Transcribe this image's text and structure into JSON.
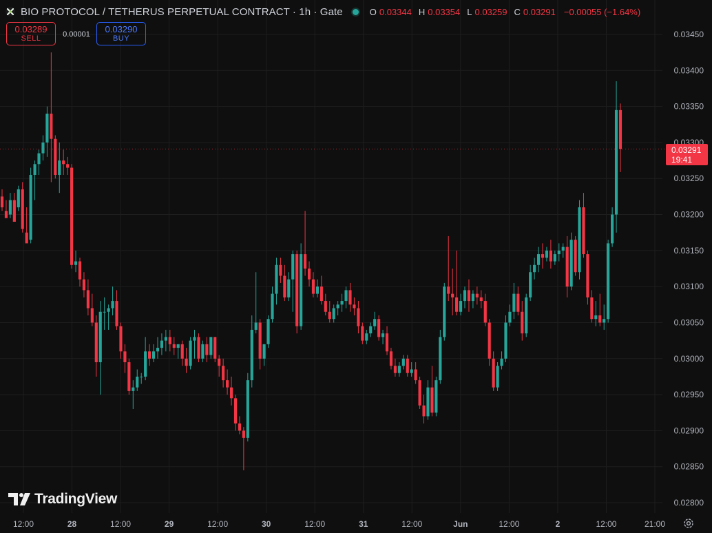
{
  "header": {
    "title": "BIO PROTOCOL / TETHERUS PERPETUAL CONTRACT · 1h · Gate",
    "ohlc": [
      {
        "k": "O",
        "v": "0.03344"
      },
      {
        "k": "H",
        "v": "0.03354"
      },
      {
        "k": "L",
        "v": "0.03259"
      },
      {
        "k": "C",
        "v": "0.03291"
      }
    ],
    "change": "−0.00055 (−1.64%)"
  },
  "trade": {
    "sell_price": "0.03289",
    "sell_label": "SELL",
    "spread": "0.00001",
    "buy_price": "0.03290",
    "buy_label": "BUY"
  },
  "price_tag": {
    "price": "0.03291",
    "countdown": "19:41"
  },
  "branding": {
    "name": "TradingView"
  },
  "colors": {
    "up": "#26a69a",
    "down": "#f23645",
    "background": "#0f0f0f",
    "grid": "#1e1e1e",
    "axis_text": "#b2b5be"
  },
  "chart_data": {
    "type": "candlestick",
    "title": "BIO PROTOCOL / TETHERUS PERPETUAL CONTRACT · 1h · Gate",
    "ylim": [
      0.028,
      0.0345
    ],
    "y_ticks": [
      "0.03450",
      "0.03400",
      "0.03350",
      "0.03300",
      "0.03250",
      "0.03200",
      "0.03150",
      "0.03100",
      "0.03050",
      "0.03000",
      "0.02950",
      "0.02900",
      "0.02850",
      "0.02800"
    ],
    "x_ticks": [
      "12:00",
      "28",
      "12:00",
      "29",
      "12:00",
      "30",
      "12:00",
      "31",
      "12:00",
      "Jun",
      "12:00",
      "2",
      "12:00",
      "21:00"
    ],
    "grid": true,
    "last_price": 0.03291,
    "candles": [
      [
        0.03225,
        0.03235,
        0.0321,
        0.03205
      ],
      [
        0.03205,
        0.0322,
        0.03195,
        0.032
      ],
      [
        0.032,
        0.0323,
        0.0322,
        0.03195
      ],
      [
        0.0322,
        0.0323,
        0.0319,
        0.0321
      ],
      [
        0.0321,
        0.0324,
        0.03235,
        0.03205
      ],
      [
        0.03235,
        0.03245,
        0.0318,
        0.03175
      ],
      [
        0.03175,
        0.0321,
        0.0316,
        0.03165
      ],
      [
        0.03165,
        0.03265,
        0.03255,
        0.0316
      ],
      [
        0.03255,
        0.03275,
        0.0327,
        0.0322
      ],
      [
        0.0327,
        0.0329,
        0.03285,
        0.03255
      ],
      [
        0.03285,
        0.0331,
        0.033,
        0.03275
      ],
      [
        0.033,
        0.0335,
        0.0334,
        0.0328
      ],
      [
        0.0334,
        0.03425,
        0.03305,
        0.03245
      ],
      [
        0.03305,
        0.0331,
        0.03255,
        0.0325
      ],
      [
        0.03255,
        0.033,
        0.03275,
        0.0323
      ],
      [
        0.03275,
        0.0329,
        0.0327,
        0.03255
      ],
      [
        0.0327,
        0.0328,
        0.03265,
        0.03255
      ],
      [
        0.03265,
        0.0327,
        0.0313,
        0.03125
      ],
      [
        0.0313,
        0.0315,
        0.03135,
        0.0312
      ],
      [
        0.03135,
        0.0314,
        0.0311,
        0.031
      ],
      [
        0.0311,
        0.0312,
        0.03095,
        0.03085
      ],
      [
        0.03095,
        0.0311,
        0.0307,
        0.0306
      ],
      [
        0.0307,
        0.0309,
        0.0305,
        0.03045
      ],
      [
        0.0305,
        0.0306,
        0.02995,
        0.02975
      ],
      [
        0.02995,
        0.0308,
        0.03065,
        0.0295
      ],
      [
        0.03065,
        0.03085,
        0.03065,
        0.0304
      ],
      [
        0.03065,
        0.03075,
        0.0307,
        0.0304
      ],
      [
        0.0307,
        0.031,
        0.0308,
        0.0306
      ],
      [
        0.0308,
        0.03095,
        0.03045,
        0.0304
      ],
      [
        0.03045,
        0.0305,
        0.0301,
        0.03
      ],
      [
        0.0301,
        0.0302,
        0.02995,
        0.0298
      ],
      [
        0.02995,
        0.03,
        0.02955,
        0.0295
      ],
      [
        0.02955,
        0.0297,
        0.0296,
        0.0293
      ],
      [
        0.0296,
        0.02985,
        0.02975,
        0.02955
      ],
      [
        0.02975,
        0.0298,
        0.02975,
        0.02965
      ],
      [
        0.02975,
        0.0303,
        0.0301,
        0.0297
      ],
      [
        0.0301,
        0.0302,
        0.03,
        0.0299
      ],
      [
        0.03,
        0.0302,
        0.0301,
        0.02995
      ],
      [
        0.0301,
        0.0303,
        0.03015,
        0.03
      ],
      [
        0.03015,
        0.03035,
        0.03025,
        0.03005
      ],
      [
        0.03025,
        0.0304,
        0.0303,
        0.0301
      ],
      [
        0.0303,
        0.0304,
        0.0302,
        0.0301
      ],
      [
        0.0302,
        0.0303,
        0.03015,
        0.03005
      ],
      [
        0.03015,
        0.0302,
        0.0302,
        0.03
      ],
      [
        0.0302,
        0.03025,
        0.03,
        0.0299
      ],
      [
        0.03,
        0.03015,
        0.0299,
        0.0298
      ],
      [
        0.0299,
        0.0303,
        0.03025,
        0.02985
      ],
      [
        0.03025,
        0.0304,
        0.0303,
        0.03
      ],
      [
        0.0303,
        0.03035,
        0.03,
        0.02995
      ],
      [
        0.03,
        0.03025,
        0.0302,
        0.02995
      ],
      [
        0.0302,
        0.0303,
        0.03005,
        0.02995
      ],
      [
        0.03005,
        0.0303,
        0.0303,
        0.03
      ],
      [
        0.0303,
        0.0303,
        0.03,
        0.02995
      ],
      [
        0.03,
        0.03005,
        0.0299,
        0.02975
      ],
      [
        0.0299,
        0.03,
        0.0297,
        0.0296
      ],
      [
        0.0297,
        0.02985,
        0.0296,
        0.0295
      ],
      [
        0.0296,
        0.02975,
        0.02945,
        0.02935
      ],
      [
        0.02945,
        0.0295,
        0.0291,
        0.029
      ],
      [
        0.0291,
        0.0292,
        0.029,
        0.02895
      ],
      [
        0.029,
        0.02905,
        0.0289,
        0.02845
      ],
      [
        0.0289,
        0.0298,
        0.0297,
        0.02885
      ],
      [
        0.0297,
        0.0306,
        0.0304,
        0.0296
      ],
      [
        0.0304,
        0.0312,
        0.0305,
        0.03035
      ],
      [
        0.0305,
        0.03055,
        0.03,
        0.02985
      ],
      [
        0.03,
        0.0302,
        0.0302,
        0.0299
      ],
      [
        0.0302,
        0.0306,
        0.03055,
        0.03015
      ],
      [
        0.03055,
        0.031,
        0.0309,
        0.0305
      ],
      [
        0.0309,
        0.0314,
        0.0313,
        0.03075
      ],
      [
        0.0313,
        0.0314,
        0.03115,
        0.03105
      ],
      [
        0.03115,
        0.0313,
        0.03085,
        0.0308
      ],
      [
        0.03085,
        0.0312,
        0.0311,
        0.0308
      ],
      [
        0.0311,
        0.0315,
        0.03145,
        0.03065
      ],
      [
        0.03145,
        0.0315,
        0.03045,
        0.03035
      ],
      [
        0.03045,
        0.0316,
        0.03145,
        0.0304
      ],
      [
        0.03145,
        0.03205,
        0.03125,
        0.03115
      ],
      [
        0.03125,
        0.03135,
        0.0311,
        0.031
      ],
      [
        0.0311,
        0.0312,
        0.0309,
        0.03085
      ],
      [
        0.0309,
        0.0311,
        0.031,
        0.03085
      ],
      [
        0.031,
        0.03115,
        0.0308,
        0.03075
      ],
      [
        0.0308,
        0.0309,
        0.03065,
        0.0306
      ],
      [
        0.03065,
        0.0308,
        0.03055,
        0.0305
      ],
      [
        0.03055,
        0.03075,
        0.0307,
        0.0305
      ],
      [
        0.0307,
        0.0308,
        0.03075,
        0.0306
      ],
      [
        0.03075,
        0.0309,
        0.0308,
        0.03065
      ],
      [
        0.0308,
        0.031,
        0.03095,
        0.0307
      ],
      [
        0.03095,
        0.03105,
        0.03075,
        0.03065
      ],
      [
        0.03075,
        0.03085,
        0.0307,
        0.0306
      ],
      [
        0.0307,
        0.0308,
        0.03045,
        0.03035
      ],
      [
        0.03045,
        0.0305,
        0.03025,
        0.0302
      ],
      [
        0.03025,
        0.0304,
        0.03035,
        0.0302
      ],
      [
        0.03035,
        0.0305,
        0.03045,
        0.0303
      ],
      [
        0.03045,
        0.03065,
        0.03055,
        0.0304
      ],
      [
        0.03055,
        0.0306,
        0.0303,
        0.03025
      ],
      [
        0.0303,
        0.0304,
        0.03035,
        0.0302
      ],
      [
        0.03035,
        0.03045,
        0.0301,
        0.03005
      ],
      [
        0.0301,
        0.03015,
        0.0299,
        0.02985
      ],
      [
        0.0299,
        0.03,
        0.0298,
        0.02975
      ],
      [
        0.0298,
        0.02995,
        0.0299,
        0.02975
      ],
      [
        0.0299,
        0.03005,
        0.03,
        0.02985
      ],
      [
        0.03,
        0.03005,
        0.0298,
        0.02975
      ],
      [
        0.0298,
        0.02995,
        0.02985,
        0.02975
      ],
      [
        0.02985,
        0.02995,
        0.0297,
        0.02965
      ],
      [
        0.0297,
        0.02975,
        0.02935,
        0.0293
      ],
      [
        0.02935,
        0.0295,
        0.0292,
        0.0291
      ],
      [
        0.0292,
        0.0297,
        0.0296,
        0.02915
      ],
      [
        0.0296,
        0.0299,
        0.02925,
        0.0292
      ],
      [
        0.02925,
        0.02975,
        0.0297,
        0.0292
      ],
      [
        0.0297,
        0.0304,
        0.0303,
        0.02965
      ],
      [
        0.0303,
        0.03105,
        0.031,
        0.03025
      ],
      [
        0.031,
        0.0317,
        0.0309,
        0.0308
      ],
      [
        0.0309,
        0.03125,
        0.03085,
        0.0306
      ],
      [
        0.03085,
        0.0315,
        0.03065,
        0.0306
      ],
      [
        0.03065,
        0.0309,
        0.0308,
        0.0306
      ],
      [
        0.0308,
        0.031,
        0.03095,
        0.0307
      ],
      [
        0.03095,
        0.0311,
        0.0308,
        0.03065
      ],
      [
        0.0308,
        0.03095,
        0.0309,
        0.0307
      ],
      [
        0.0309,
        0.031,
        0.03085,
        0.03075
      ],
      [
        0.03085,
        0.03095,
        0.0308,
        0.0307
      ],
      [
        0.0308,
        0.0309,
        0.0305,
        0.03045
      ],
      [
        0.0305,
        0.03055,
        0.03,
        0.0299
      ],
      [
        0.03,
        0.0301,
        0.0296,
        0.02955
      ],
      [
        0.0296,
        0.02995,
        0.0299,
        0.02955
      ],
      [
        0.0299,
        0.0301,
        0.03,
        0.02985
      ],
      [
        0.03,
        0.0306,
        0.0305,
        0.02995
      ],
      [
        0.0305,
        0.03075,
        0.03065,
        0.03045
      ],
      [
        0.03065,
        0.03105,
        0.0309,
        0.03055
      ],
      [
        0.0309,
        0.031,
        0.03065,
        0.0306
      ],
      [
        0.03065,
        0.0308,
        0.03035,
        0.03025
      ],
      [
        0.03035,
        0.0309,
        0.03085,
        0.0303
      ],
      [
        0.03085,
        0.0313,
        0.0312,
        0.0308
      ],
      [
        0.0312,
        0.0314,
        0.0313,
        0.0311
      ],
      [
        0.0313,
        0.03155,
        0.03145,
        0.0312
      ],
      [
        0.03145,
        0.0316,
        0.0314,
        0.03125
      ],
      [
        0.0314,
        0.03155,
        0.0315,
        0.03135
      ],
      [
        0.0315,
        0.03165,
        0.03135,
        0.03125
      ],
      [
        0.03135,
        0.0315,
        0.03145,
        0.0313
      ],
      [
        0.03145,
        0.0316,
        0.0315,
        0.03135
      ],
      [
        0.0315,
        0.0316,
        0.03155,
        0.0314
      ],
      [
        0.03155,
        0.0317,
        0.031,
        0.03085
      ],
      [
        0.031,
        0.03175,
        0.03165,
        0.03095
      ],
      [
        0.03165,
        0.0317,
        0.0312,
        0.03115
      ],
      [
        0.0312,
        0.0322,
        0.0321,
        0.0311
      ],
      [
        0.0321,
        0.0323,
        0.03145,
        0.0314
      ],
      [
        0.03145,
        0.0315,
        0.03085,
        0.03075
      ],
      [
        0.03085,
        0.03095,
        0.03055,
        0.0305
      ],
      [
        0.03055,
        0.0308,
        0.0306,
        0.03045
      ],
      [
        0.0306,
        0.0309,
        0.0305,
        0.03045
      ],
      [
        0.0305,
        0.03075,
        0.03055,
        0.0304
      ],
      [
        0.03055,
        0.03165,
        0.0316,
        0.0305
      ],
      [
        0.0316,
        0.0321,
        0.032,
        0.03155
      ],
      [
        0.032,
        0.03385,
        0.03345,
        0.03175
      ],
      [
        0.03345,
        0.03354,
        0.03291,
        0.03259
      ]
    ]
  }
}
